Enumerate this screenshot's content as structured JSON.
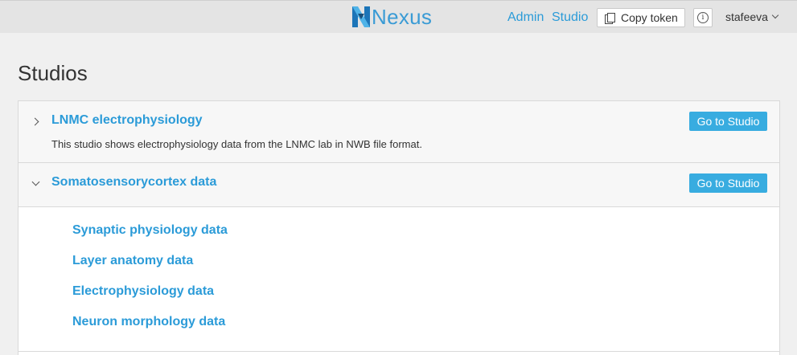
{
  "header": {
    "logo_text": "Nexus",
    "admin_link": "Admin",
    "studio_link": "Studio",
    "copy_token_label": "Copy token",
    "info_icon": "i",
    "username": "stafeeva"
  },
  "page": {
    "title": "Studios"
  },
  "studios": [
    {
      "title": "LNMC electrophysiology",
      "description": "This studio shows electrophysiology data from the LNMC lab in NWB file format.",
      "button": "Go to Studio",
      "expanded": false
    },
    {
      "title": "Somatosensorycortex data",
      "description": "",
      "button": "Go to Studio",
      "expanded": true,
      "workspaces": [
        "Synaptic physiology data",
        "Layer anatomy data",
        "Electrophysiology data",
        "Neuron morphology data"
      ]
    }
  ],
  "colors": {
    "accent": "#2b9bd8",
    "button": "#38ace0",
    "topbar": "#e4e4e4",
    "background": "#f0f0f0"
  }
}
